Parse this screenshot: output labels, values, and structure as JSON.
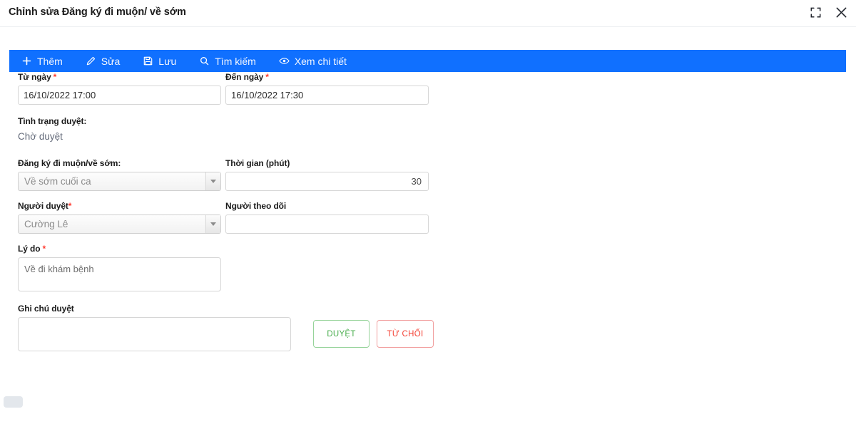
{
  "window": {
    "title": "Chỉnh sửa Đăng ký đi muộn/ về sớm",
    "expand_icon": "expand-icon",
    "close_icon": "close-icon"
  },
  "toolbar": {
    "items": [
      {
        "label": "Thêm",
        "icon": "plus-icon"
      },
      {
        "label": "Sửa",
        "icon": "pencil-icon"
      },
      {
        "label": "Lưu",
        "icon": "save-icon"
      },
      {
        "label": "Tìm kiếm",
        "icon": "search-icon"
      },
      {
        "label": "Xem chi tiết",
        "icon": "eye-icon"
      }
    ]
  },
  "form": {
    "from_date": {
      "label": "Từ ngày",
      "required": "*",
      "value": "16/10/2022 17:00",
      "placeholder": ""
    },
    "to_date": {
      "label": "Đến ngày",
      "required": "*",
      "value": "16/10/2022 17:30",
      "placeholder": ""
    },
    "status": {
      "label": "Tình trạng duyệt:",
      "value": "Chờ duyệt"
    },
    "register_type": {
      "label": "Đăng ký đi muộn/về sớm:",
      "value": "Về sớm cuối ca"
    },
    "duration": {
      "label": "Thời gian (phút)",
      "value": "30",
      "placeholder": ""
    },
    "approver": {
      "label": "Người duyệt",
      "required": "*",
      "value": "Cường Lê"
    },
    "follower": {
      "label": "Người theo dõi",
      "value": "",
      "placeholder": ""
    },
    "reason": {
      "label": "Lý do",
      "required": "*",
      "value": "Về đi khám bệnh",
      "placeholder": ""
    },
    "approve_note": {
      "label": "Ghi chú duyệt",
      "value": "",
      "placeholder": ""
    },
    "approve_button": "DUYỆT",
    "reject_button": "TỪ CHỐI"
  },
  "colors": {
    "toolbar_blue": "#1070ff",
    "required_red": "#ff3b30",
    "approve_green": "#4caf50",
    "reject_red": "#f44336"
  }
}
